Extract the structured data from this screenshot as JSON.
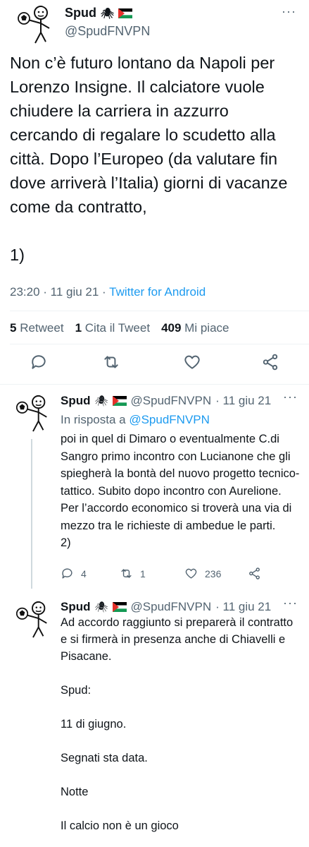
{
  "main_tweet": {
    "name": "Spud",
    "handle": "@SpudFNVPN",
    "more": "···",
    "text": "Non c’è futuro lontano da Napoli per Lorenzo Insigne. Il calciatore vuole chiudere la carriera in azzurro cercando di regalare lo scudetto alla città. Dopo l’Europeo (da valutare fin dove arriverà l’Italia) giorni di vacanze come da contratto,\n\n1)",
    "time": "23:20 · 11 giu 21 · ",
    "source": "Twitter for Android",
    "stats": {
      "retweets_count": "5",
      "retweets_label": "Retweet",
      "quotes_count": "1",
      "quotes_label": "Cita il Tweet",
      "likes_count": "409",
      "likes_label": "Mi piace"
    },
    "icons": [
      "reply-icon",
      "retweet-icon",
      "like-icon",
      "share-icon"
    ]
  },
  "replies": [
    {
      "name": "Spud",
      "handle": "@SpudFNVPN",
      "date": "· 11 giu 21",
      "more": "···",
      "reply_prefix": "In risposta a ",
      "reply_to": "@SpudFNVPN",
      "text": "poi in quel di Dimaro o eventualmente C.di Sangro primo incontro con Lucianone che gli spiegherà la bontà del nuovo progetto tecnico-tattico. Subito dopo incontro con Aurelione. Per l’accordo economico si troverà una via di mezzo tra le richieste di ambedue le parti.\n2)",
      "reply_count": "4",
      "retweet_count": "1",
      "like_count": "236"
    },
    {
      "name": "Spud",
      "handle": "@SpudFNVPN",
      "date": "· 11 giu 21",
      "more": "···",
      "text": "Ad accordo raggiunto si preparerà il contratto e si firmerà in presenza anche di Chiavelli e Pisacane.\n\nSpud:\n\n11 di giugno.\n\nSegnati sta data.\n\nNotte\n\nIl calcio non è un gioco"
    }
  ],
  "colors": {
    "accent": "#1d9bf0",
    "secondary_text": "#536471",
    "border": "#eff3f4"
  }
}
